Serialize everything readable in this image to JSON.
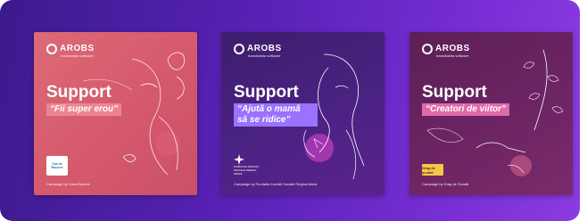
{
  "brand": {
    "name": "AROBS",
    "subtitle": "transilvania software"
  },
  "cards": [
    {
      "headline": "Support",
      "tagline": "“Fii super erou”",
      "partner_label": "Cas de Bucurie",
      "credit": "Campaign by Casa Bucurie"
    },
    {
      "headline": "Support",
      "tagline_line1": "“Ajută o mamă",
      "tagline_line2": "să se ridice”",
      "partner_label": "FUNDAȚIA INOVAȚII SOCIALE REGINA MARIA",
      "credit": "Campaign by Fundatia Inovatii Sociale Regina Maria"
    },
    {
      "headline": "Support",
      "tagline": "“Creatori de viitor”",
      "partner_label": "Drag de școală",
      "credit": "Campaign by Drag de Scoală"
    }
  ]
}
